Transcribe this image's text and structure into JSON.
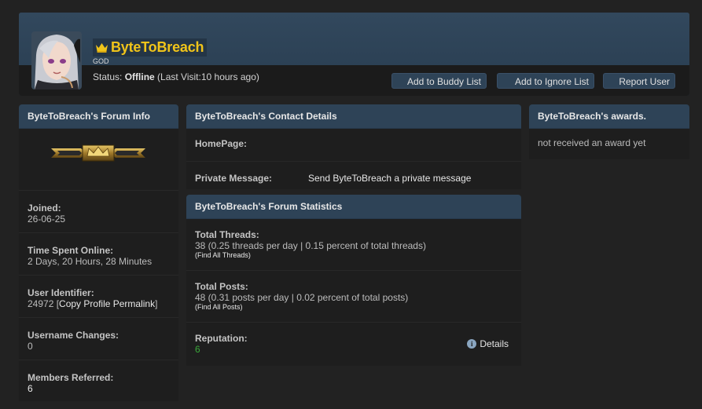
{
  "profile": {
    "username": "ByteToBreach",
    "rank": "GOD",
    "status_label": "Status:",
    "status_value": "Offline",
    "last_visit": "(Last Visit:10 hours ago)",
    "colors": {
      "username": "#f0c41a",
      "header": "#2e4357"
    },
    "buttons": {
      "buddy": "Add to Buddy List",
      "ignore": "Add to Ignore List",
      "report": "Report User"
    }
  },
  "forum_info": {
    "title": "ByteToBreach's Forum Info",
    "items": [
      {
        "label": "Joined:",
        "value": "26-06-25"
      },
      {
        "label": "Time Spent Online:",
        "value": "2 Days, 20 Hours, 28 Minutes"
      },
      {
        "label": "User Identifier:",
        "value": "24972 [",
        "link": "Copy Profile Permalink",
        "suffix": "]"
      },
      {
        "label": "Username Changes:",
        "value": "0"
      },
      {
        "label": "Members Referred:",
        "value": "6"
      }
    ]
  },
  "contact": {
    "title": "ByteToBreach's Contact Details",
    "homepage_label": "HomePage:",
    "pm_label": "Private Message:",
    "pm_link": "Send ByteToBreach a private message"
  },
  "stats": {
    "title": "ByteToBreach's Forum Statistics",
    "threads_label": "Total Threads:",
    "threads_value": "38 (0.25 threads per day | 0.15 percent of total threads)",
    "threads_link": "Find All Threads",
    "posts_label": "Total Posts:",
    "posts_value": "48 (0.31 posts per day | 0.02 percent of total posts)",
    "posts_link": "Find All Posts",
    "rep_label": "Reputation:",
    "rep_value": "6",
    "rep_color": "#3aa83a",
    "details_label": "Details"
  },
  "awards": {
    "title": "ByteToBreach's awards.",
    "empty_text": "not received an award yet"
  }
}
